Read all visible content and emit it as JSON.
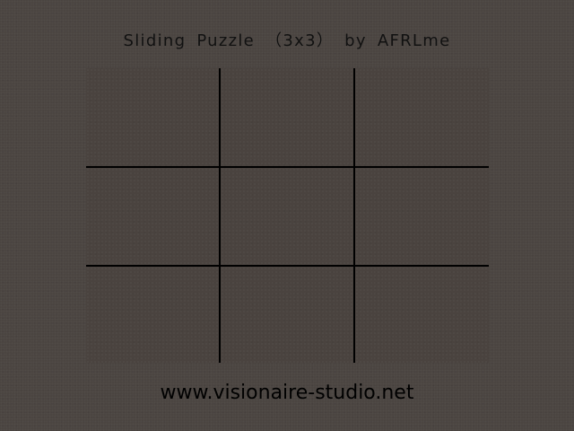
{
  "header": {
    "title": "Sliding  Puzzle （3x3） by  AFRLme"
  },
  "footer": {
    "url_text": "www.visionaire-studio.net"
  },
  "puzzle": {
    "rows": 3,
    "columns": 3,
    "tiles": [
      {
        "label": ""
      },
      {
        "label": ""
      },
      {
        "label": ""
      },
      {
        "label": ""
      },
      {
        "label": ""
      },
      {
        "label": ""
      },
      {
        "label": ""
      },
      {
        "label": ""
      },
      {
        "label": ""
      }
    ]
  },
  "colors": {
    "background": "#4b4541",
    "board": "#49423e",
    "grid_lines": "#000000",
    "text": "#111111"
  }
}
